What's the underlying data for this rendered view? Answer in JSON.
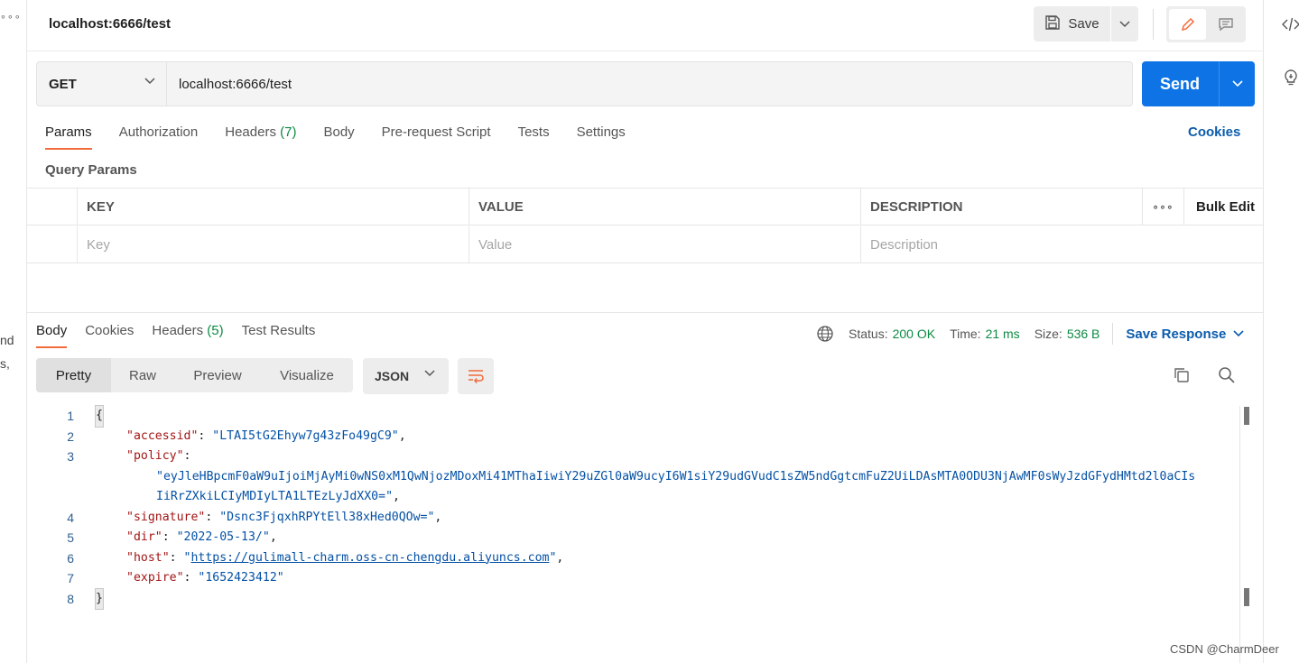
{
  "left_strip": {
    "dots": "∘∘∘",
    "frag1": "nd",
    "frag2": "s,"
  },
  "header": {
    "tab_title": "localhost:6666/test",
    "save_label": "Save"
  },
  "request": {
    "method": "GET",
    "url": "localhost:6666/test",
    "send_label": "Send"
  },
  "request_tabs": [
    {
      "label": "Params",
      "count": ""
    },
    {
      "label": "Authorization",
      "count": ""
    },
    {
      "label": "Headers",
      "count": "(7)"
    },
    {
      "label": "Body",
      "count": ""
    },
    {
      "label": "Pre-request Script",
      "count": ""
    },
    {
      "label": "Tests",
      "count": ""
    },
    {
      "label": "Settings",
      "count": ""
    }
  ],
  "cookies_label": "Cookies",
  "query_params": {
    "title": "Query Params",
    "columns": [
      "KEY",
      "VALUE",
      "DESCRIPTION"
    ],
    "more_label": "∘∘∘",
    "bulk_edit_label": "Bulk Edit",
    "placeholders": [
      "Key",
      "Value",
      "Description"
    ]
  },
  "response": {
    "tabs": [
      {
        "label": "Body",
        "count": ""
      },
      {
        "label": "Cookies",
        "count": ""
      },
      {
        "label": "Headers",
        "count": "(5)"
      },
      {
        "label": "Test Results",
        "count": ""
      }
    ],
    "status_label": "Status:",
    "status_value": "200 OK",
    "time_label": "Time:",
    "time_value": "21 ms",
    "size_label": "Size:",
    "size_value": "536 B",
    "save_response_label": "Save Response",
    "view_modes": [
      "Pretty",
      "Raw",
      "Preview",
      "Visualize"
    ],
    "format": "JSON"
  },
  "code": {
    "line_numbers": [
      "1",
      "2",
      "3",
      "4",
      "5",
      "6",
      "7",
      "8"
    ],
    "open_brace": "{",
    "close_brace": "}",
    "accessid_key": "\"accessid\"",
    "accessid_val": "\"LTAI5tG2Ehyw7g43zFo49gC9\"",
    "policy_key": "\"policy\"",
    "policy_val_1": "\"eyJleHBpcmF0aW9uIjoiMjAyMi0wNS0xM1QwNjozMDoxMi41MThaIiwiY29uZGl0aW9ucyI6W1siY29udGVudC1sZW5ndGgtcmFuZ2UiLDAsMTA0ODU3NjAwMF0sWyJzdGFydHMtd2l0aCIs",
    "policy_val_2": "IiRrZXkiLCIyMDIyLTA1LTEzLyJdXX0=\"",
    "signature_key": "\"signature\"",
    "signature_val": "\"Dsnc3FjqxhRPYtEll38xHed0QOw=\"",
    "dir_key": "\"dir\"",
    "dir_val": "\"2022-05-13/\"",
    "host_key": "\"host\"",
    "host_url": "https://gulimall-charm.oss-cn-chengdu.aliyuncs.com",
    "expire_key": "\"expire\"",
    "expire_val": "\"1652423412\""
  },
  "watermark": "CSDN @CharmDeer",
  "colors": {
    "accent": "#f26b3a",
    "send_blue": "#0e74e6",
    "link_blue": "#0b5cad",
    "status_green": "#0c8a43"
  }
}
